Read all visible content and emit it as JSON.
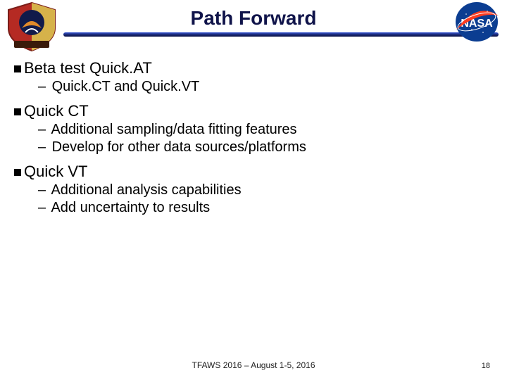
{
  "title": "Path Forward",
  "sections": [
    {
      "head": "Beta test Quick.AT",
      "items": [
        "Quick.CT and Quick.VT"
      ]
    },
    {
      "head": "Quick CT",
      "items": [
        "Additional sampling/data fitting features",
        "Develop for other data sources/platforms"
      ]
    },
    {
      "head": "Quick VT",
      "items": [
        "Additional analysis capabilities",
        "Add uncertainty to results"
      ]
    }
  ],
  "footer": "TFAWS 2016 – August 1-5, 2016",
  "page_number": "18",
  "logos": {
    "left_alt": "jet-propulsion-laboratory-shield",
    "right_alt": "nasa-meatball"
  }
}
